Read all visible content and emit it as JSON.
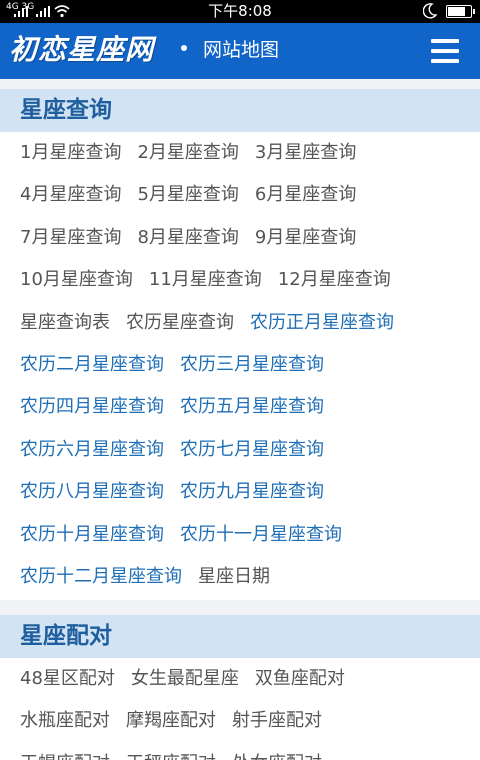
{
  "status_bar": {
    "time": "下午8:08",
    "signal_text": "4G 3G"
  },
  "header": {
    "logo": "初恋星座网",
    "subtitle": "网站地图",
    "menu_icon": "hamburger-menu-icon"
  },
  "colors": {
    "header_bg": "#1165c8",
    "section_bg": "#d2e3f3",
    "section_title": "#1f5f9f",
    "link_gray": "#555555",
    "link_blue": "#1f6fb7"
  },
  "sections": [
    {
      "title": "星座查询",
      "rows": [
        [
          {
            "label": "1月星座查询",
            "style": "gray"
          },
          {
            "label": "2月星座查询",
            "style": "gray"
          },
          {
            "label": "3月星座查询",
            "style": "gray"
          }
        ],
        [
          {
            "label": "4月星座查询",
            "style": "gray"
          },
          {
            "label": "5月星座查询",
            "style": "gray"
          },
          {
            "label": "6月星座查询",
            "style": "gray"
          }
        ],
        [
          {
            "label": "7月星座查询",
            "style": "gray"
          },
          {
            "label": "8月星座查询",
            "style": "gray"
          },
          {
            "label": "9月星座查询",
            "style": "gray"
          }
        ],
        [
          {
            "label": "10月星座查询",
            "style": "gray"
          },
          {
            "label": "11月星座查询",
            "style": "gray"
          },
          {
            "label": "12月星座查询",
            "style": "gray"
          }
        ],
        [
          {
            "label": "星座查询表",
            "style": "gray"
          },
          {
            "label": "农历星座查询",
            "style": "gray"
          },
          {
            "label": "农历正月星座查询",
            "style": "blue"
          }
        ],
        [
          {
            "label": "农历二月星座查询",
            "style": "blue"
          },
          {
            "label": "农历三月星座查询",
            "style": "blue"
          }
        ],
        [
          {
            "label": "农历四月星座查询",
            "style": "blue"
          },
          {
            "label": "农历五月星座查询",
            "style": "blue"
          }
        ],
        [
          {
            "label": "农历六月星座查询",
            "style": "blue"
          },
          {
            "label": "农历七月星座查询",
            "style": "blue"
          }
        ],
        [
          {
            "label": "农历八月星座查询",
            "style": "blue"
          },
          {
            "label": "农历九月星座查询",
            "style": "blue"
          }
        ],
        [
          {
            "label": "农历十月星座查询",
            "style": "blue"
          },
          {
            "label": "农历十一月星座查询",
            "style": "blue"
          }
        ],
        [
          {
            "label": "农历十二月星座查询",
            "style": "blue"
          },
          {
            "label": "星座日期",
            "style": "gray"
          }
        ]
      ]
    },
    {
      "title": "星座配对",
      "rows": [
        [
          {
            "label": "48星区配对",
            "style": "gray"
          },
          {
            "label": "女生最配星座",
            "style": "gray"
          },
          {
            "label": "双鱼座配对",
            "style": "gray"
          }
        ],
        [
          {
            "label": "水瓶座配对",
            "style": "gray"
          },
          {
            "label": "摩羯座配对",
            "style": "gray"
          },
          {
            "label": "射手座配对",
            "style": "gray"
          }
        ],
        [
          {
            "label": "天蝎座配对",
            "style": "gray"
          },
          {
            "label": "天秤座配对",
            "style": "gray"
          },
          {
            "label": "处女座配对",
            "style": "gray"
          }
        ]
      ]
    }
  ]
}
